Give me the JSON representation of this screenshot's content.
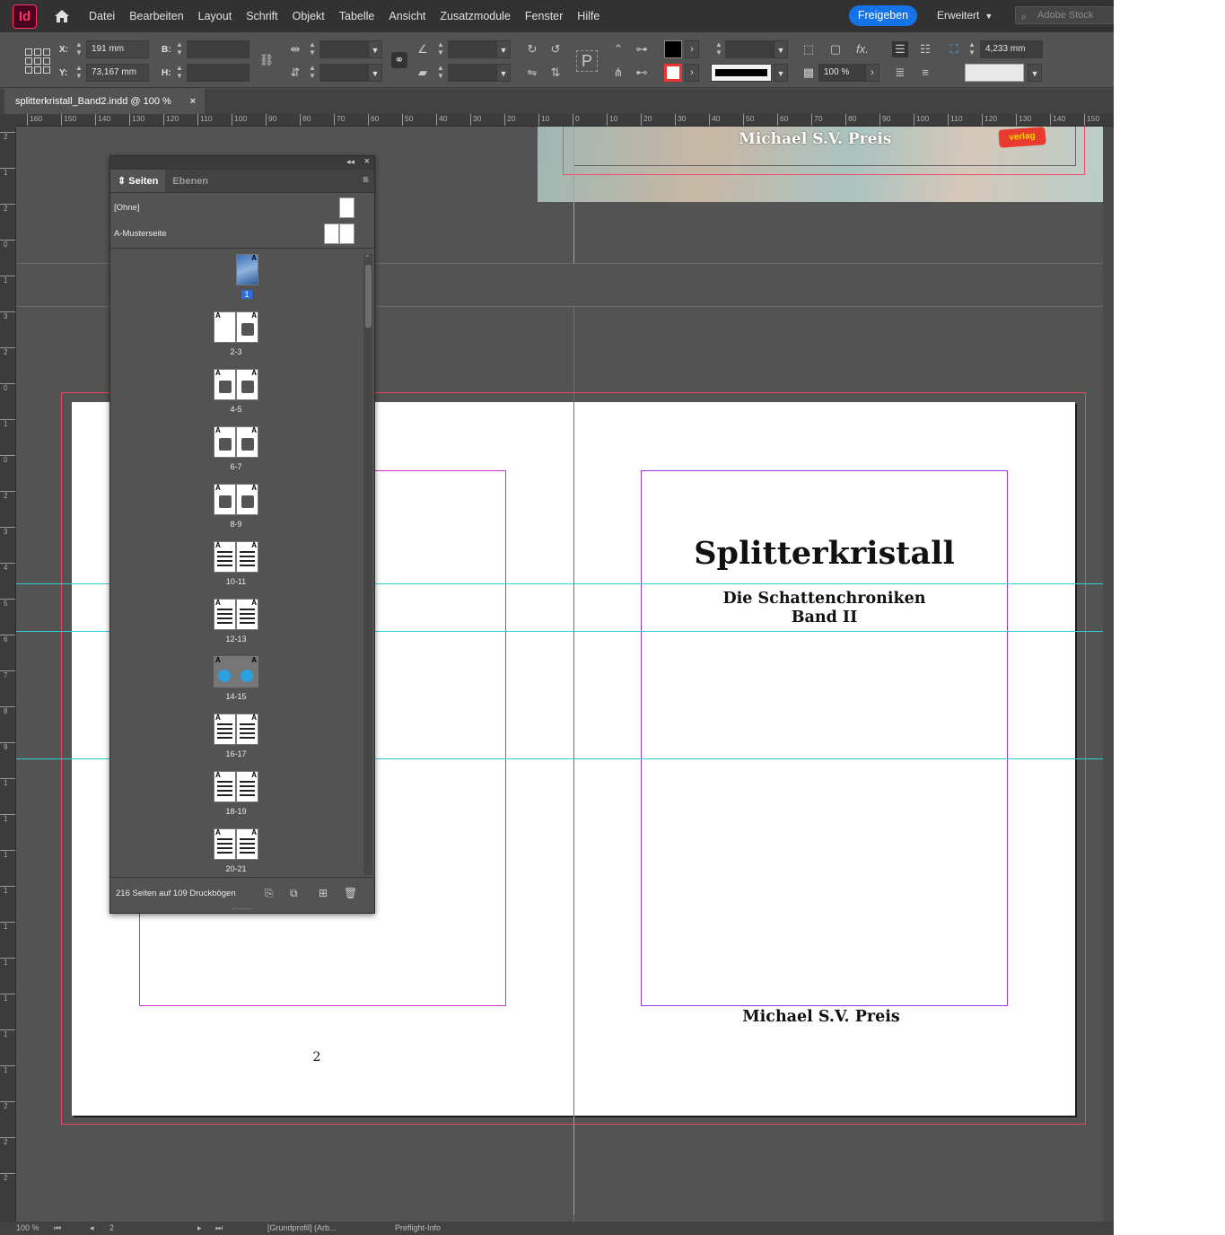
{
  "app": {
    "logo": "Id",
    "menu": [
      "Datei",
      "Bearbeiten",
      "Layout",
      "Schrift",
      "Objekt",
      "Tabelle",
      "Ansicht",
      "Zusatzmodule",
      "Fenster",
      "Hilfe"
    ],
    "share_label": "Freigeben",
    "workspace_label": "Erweitert",
    "stock_placeholder": "Adobe Stock"
  },
  "control": {
    "x_label": "X:",
    "x_value": "191 mm",
    "y_label": "Y:",
    "y_value": "73,167 mm",
    "w_label": "B:",
    "h_label": "H:",
    "scale_value": "100 %",
    "stroke_weight": "4,233 mm",
    "fill_color": "#000000"
  },
  "document": {
    "tab_title": "splitterkristall_Band2.indd @ 100 %",
    "close_symbol": "×"
  },
  "rulers": {
    "h_ticks": [
      "160",
      "150",
      "140",
      "130",
      "120",
      "110",
      "100",
      "90",
      "80",
      "70",
      "60",
      "50",
      "40",
      "30",
      "20",
      "10",
      "0",
      "10",
      "20",
      "30",
      "40",
      "50",
      "60",
      "70",
      "80",
      "90",
      "100",
      "110",
      "120",
      "130",
      "140",
      "150"
    ],
    "v_ticks": [
      "2",
      "1",
      "2",
      "0",
      "1",
      "3",
      "2",
      "0",
      "1",
      "0",
      "2",
      "3",
      "4",
      "5",
      "6",
      "7",
      "8",
      "9",
      "1",
      "1",
      "1",
      "1",
      "1",
      "1",
      "1",
      "1",
      "1",
      "2",
      "2",
      "2"
    ]
  },
  "canvas": {
    "prev_author": "Michael S.V. Preis",
    "prev_logo_text": "verlag",
    "title": "Splitterkristall",
    "subtitle_line1": "Die Schattenchroniken",
    "subtitle_line2": "Band II",
    "author": "Michael S.V. Preis",
    "left_page_number": "2"
  },
  "pages_panel": {
    "tabs": [
      "Seiten",
      "Ebenen"
    ],
    "masters": [
      "[Ohne]",
      "A-Musterseite"
    ],
    "spreads": [
      {
        "label": "1",
        "selected": true
      },
      {
        "label": "2-3"
      },
      {
        "label": "4-5"
      },
      {
        "label": "6-7"
      },
      {
        "label": "8-9"
      },
      {
        "label": "10-11"
      },
      {
        "label": "12-13"
      },
      {
        "label": "14-15"
      },
      {
        "label": "16-17"
      },
      {
        "label": "18-19"
      },
      {
        "label": "20-21"
      }
    ],
    "master_letter": "A",
    "footer_info": "216 Seiten auf 109 Druckbögen"
  },
  "status": {
    "zoom": "100 %",
    "page": "2",
    "profile": "[Grundprofil] (Arb...",
    "preflight": "Preflight-Info"
  }
}
